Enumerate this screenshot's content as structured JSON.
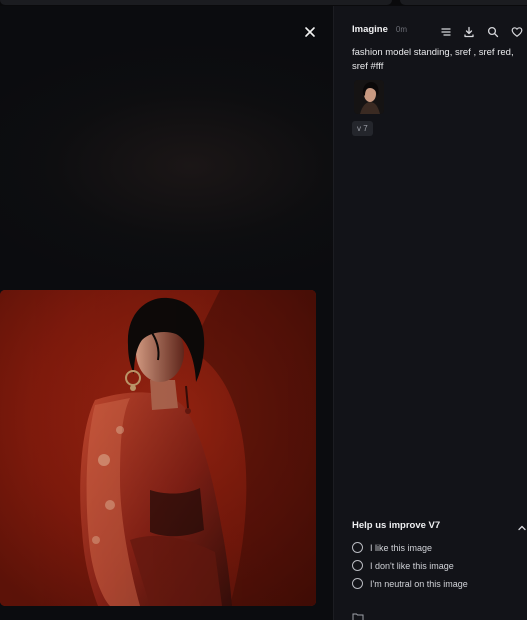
{
  "viewer": {
    "close_icon": "close-icon"
  },
  "panel": {
    "title": "Imagine",
    "time": "0m",
    "icons": [
      "sliders-icon",
      "download-icon",
      "search-icon",
      "heart-icon"
    ],
    "prompt": "fashion model standing, sref , sref red, sref #fff",
    "version_badge": "v 7"
  },
  "feedback": {
    "title": "Help us improve V7",
    "options": [
      {
        "label": "I like this image"
      },
      {
        "label": "I don't like this image"
      },
      {
        "label": "I'm neutral on this image"
      }
    ]
  },
  "colors": {
    "background": "#0c0d10",
    "panel": "#121318",
    "image_backdrop": "#8a1c0e"
  }
}
